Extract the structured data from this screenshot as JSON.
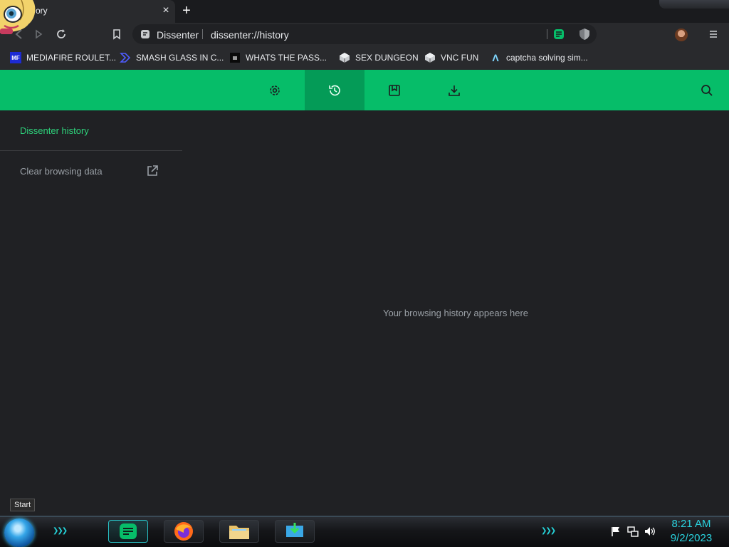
{
  "tab": {
    "title": "History",
    "visible_title": "ory",
    "close": "×"
  },
  "toolbar": {
    "new_tab": "+"
  },
  "omnibox": {
    "site": "Dissenter",
    "url": "dissenter://history"
  },
  "bookmarks": [
    {
      "label": "MEDIAFIRE ROULET...",
      "icon": "mediafire-icon",
      "badge": "MF"
    },
    {
      "label": "SMASH GLASS IN C...",
      "icon": "chevron-logo-icon",
      "badge": ""
    },
    {
      "label": "WHATS THE PASS...",
      "icon": "dark-square-icon",
      "badge": ""
    },
    {
      "label": "SEX DUNGEON",
      "icon": "cube-icon",
      "badge": ""
    },
    {
      "label": "VNC FUN",
      "icon": "cube-icon",
      "badge": ""
    },
    {
      "label": "captcha solving sim...",
      "icon": "lambda-icon",
      "badge": "Λ"
    }
  ],
  "appbar": {
    "icons": [
      "settings-icon",
      "history-icon",
      "bookmark-icon",
      "download-icon",
      "search-icon"
    ]
  },
  "sidebar": {
    "title": "Dissenter history",
    "clear_link": "Clear browsing data"
  },
  "content": {
    "empty_message": "Your browsing history appears here"
  },
  "taskbar": {
    "start_tooltip": "Start",
    "time": "8:21 AM",
    "date": "9/2/2023",
    "chevrons": "❯❯❯"
  },
  "colors": {
    "accent": "#06bd69",
    "accent_dark": "#049b57",
    "background": "#202124",
    "clock": "#2ad3df"
  }
}
